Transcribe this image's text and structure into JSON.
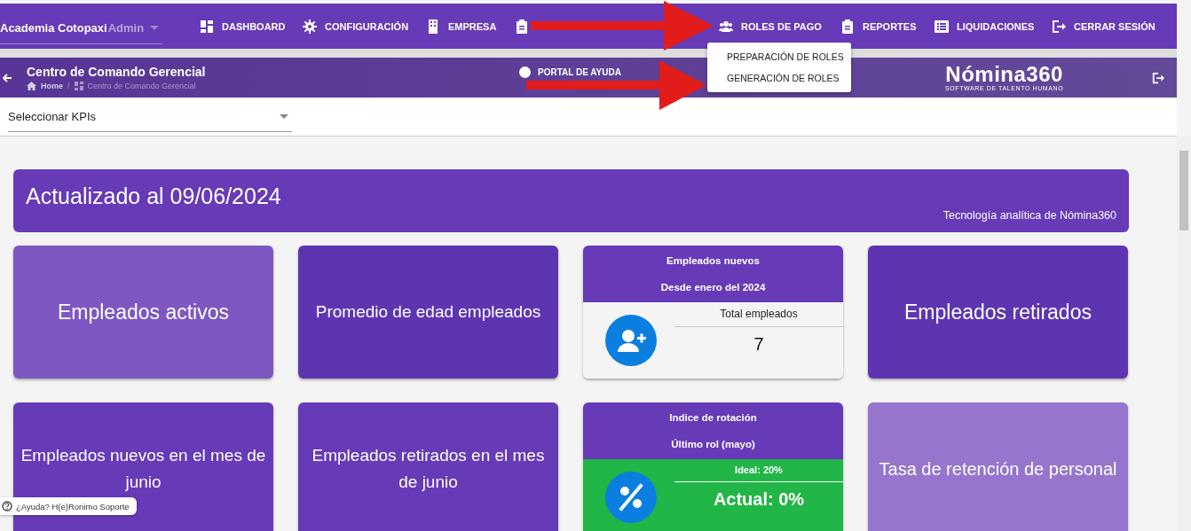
{
  "navbar": {
    "company": "Academia Cotopaxi",
    "role": "Admin",
    "items": [
      {
        "kind": "link",
        "label": "DASHBOARD"
      },
      {
        "kind": "link",
        "label": "CONFIGURACIÓN"
      },
      {
        "kind": "link",
        "label": "EMPRESA"
      },
      {
        "kind": "icon"
      },
      {
        "kind": "link",
        "label": "ROLES DE PAGO"
      },
      {
        "kind": "link",
        "label": "REPORTES"
      },
      {
        "kind": "link",
        "label": "LIQUIDACIONES"
      },
      {
        "kind": "link",
        "label": "CERRAR SESIÓN"
      }
    ]
  },
  "dropdown": [
    "PREPARACIÓN DE ROLES",
    "GENERACIÓN DE ROLES"
  ],
  "header": {
    "title": "Centro de Comando Gerencial",
    "breadcrumb": [
      "Home",
      "Centro de Comando Gerencial"
    ],
    "breadcrumb_separator": "/",
    "help_link": "PORTAL DE AYUDA",
    "logo": "Nómina360",
    "logo_tagline": "SOFTWARE DE TALENTO HUMANO"
  },
  "kpi_select": {
    "placeholder": "Seleccionar KPIs"
  },
  "banner": {
    "title": "Actualizado al 09/06/2024",
    "subtitle": "Tecnología analítica de Nómina360"
  },
  "cards": [
    {
      "kind": "plain",
      "title": "Empleados activos",
      "color": "#7e57c2"
    },
    {
      "kind": "plain",
      "title": "Promedio de edad empleados",
      "color": "#5e35b1"
    },
    {
      "kind": "count",
      "header": [
        "Empleados nuevos",
        "Desde enero del 2024"
      ],
      "label": "Total empleados",
      "value": "7",
      "color": "#f4f4f4"
    },
    {
      "kind": "plain",
      "title": "Empleados retirados",
      "color": "#5e35b1"
    },
    {
      "kind": "plain",
      "title": "Empleados nuevos en el mes de junio",
      "color": "#673ab7"
    },
    {
      "kind": "plain",
      "title": "Empleados retirados en el mes de junio",
      "color": "#673ab7"
    },
    {
      "kind": "rate",
      "header": [
        "Indice de rotación",
        "Último rol (mayo)"
      ],
      "label": "Ideal: 20%",
      "value": "Actual: 0%",
      "color": "#22b547"
    },
    {
      "kind": "plain",
      "title": "Tasa de retención de personal",
      "color": "#9575cd"
    }
  ],
  "help_chip": "¿Ayuda? H(e)Ronimo Soporte"
}
